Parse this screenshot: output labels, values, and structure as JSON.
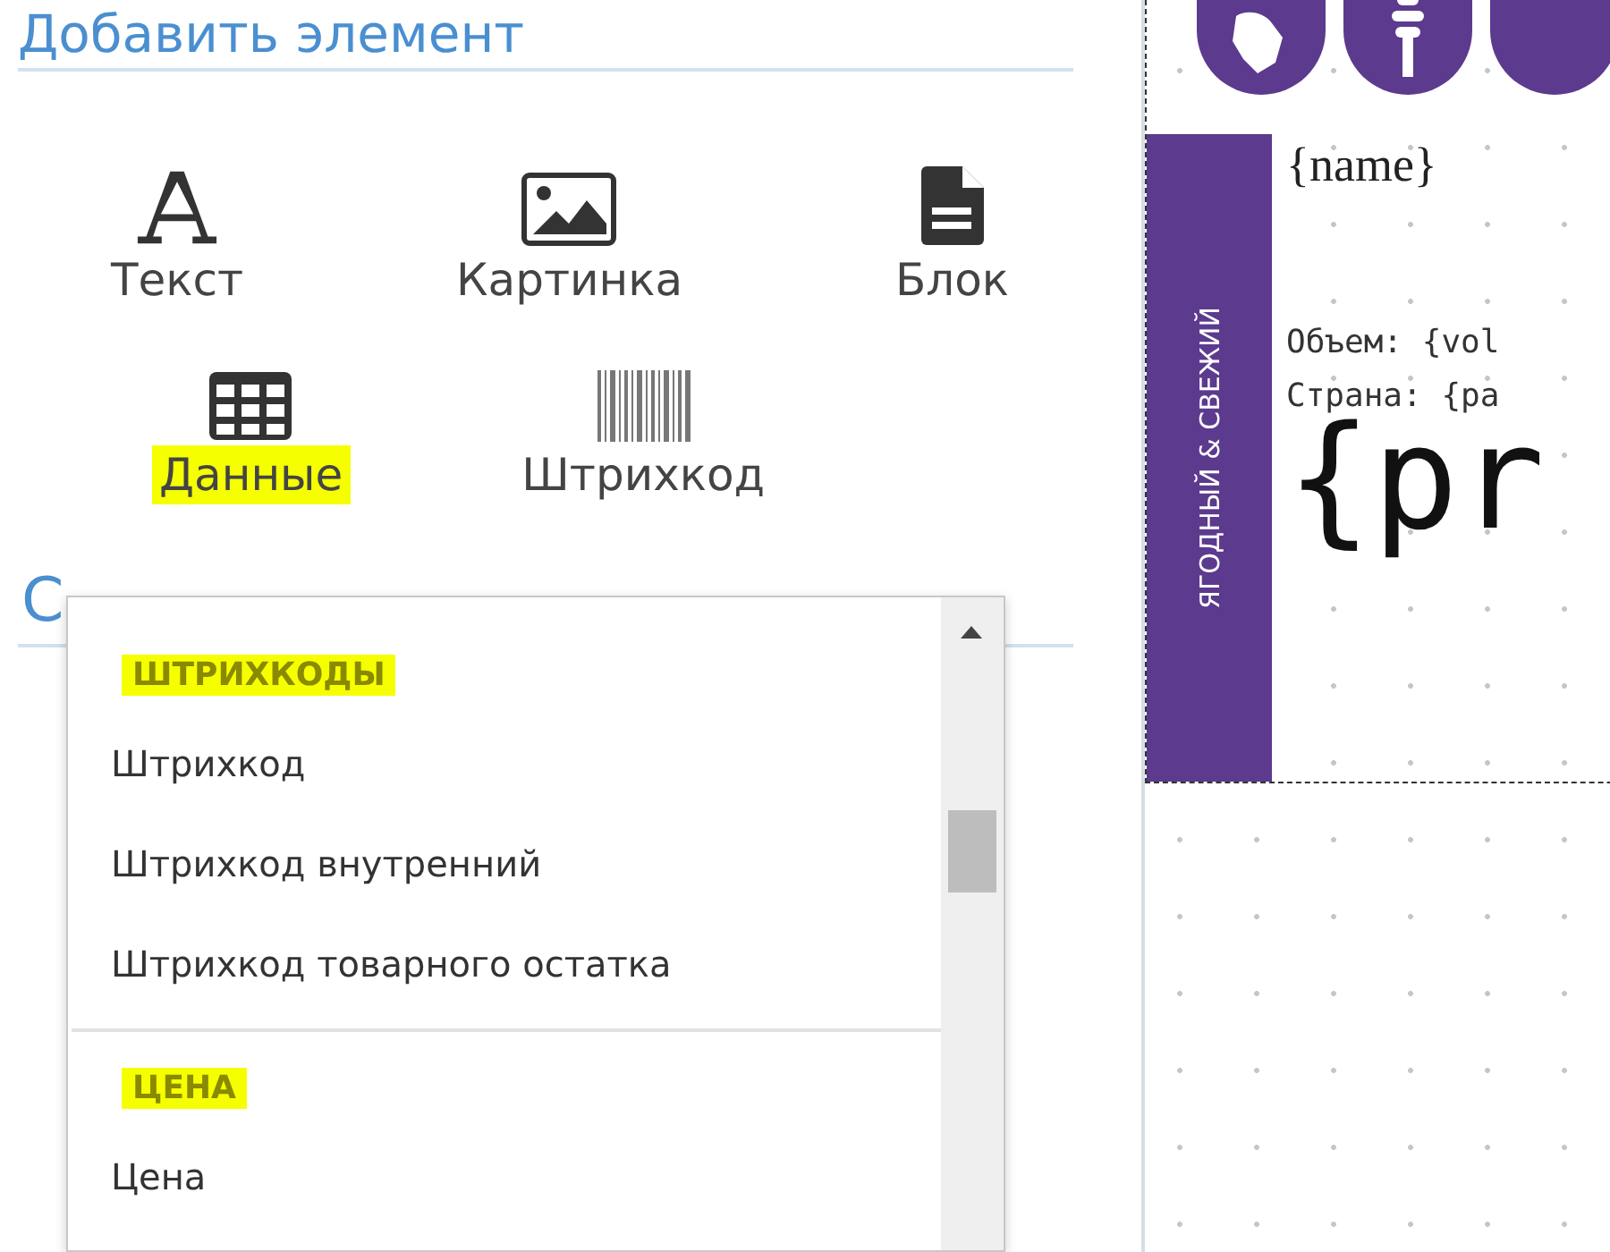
{
  "panel": {
    "title": "Добавить элемент",
    "tools": [
      {
        "kind": "text",
        "label": "Текст",
        "highlighted": false
      },
      {
        "kind": "image",
        "label": "Картинка",
        "highlighted": false
      },
      {
        "kind": "block",
        "label": "Блок",
        "highlighted": false
      },
      {
        "kind": "data",
        "label": "Данные",
        "highlighted": true
      },
      {
        "kind": "barcode",
        "label": "Штрихкод",
        "highlighted": false
      }
    ],
    "second_title": "С"
  },
  "dropdown": {
    "groups": [
      {
        "title": "ШТРИХКОДЫ",
        "highlighted": true,
        "items": [
          "Штрихкод",
          "Штрихкод внутренний",
          "Штрихкод товарного остатка"
        ]
      },
      {
        "title": "ЦЕНА",
        "highlighted": true,
        "items": [
          "Цена"
        ]
      }
    ]
  },
  "label": {
    "side_text": "ЯГОДНЫЙ & СВЕЖИЙ",
    "name_field": "{name}",
    "lines": [
      "Объем: {vol",
      "Страна: {pa"
    ],
    "price_field": "{pr"
  }
}
